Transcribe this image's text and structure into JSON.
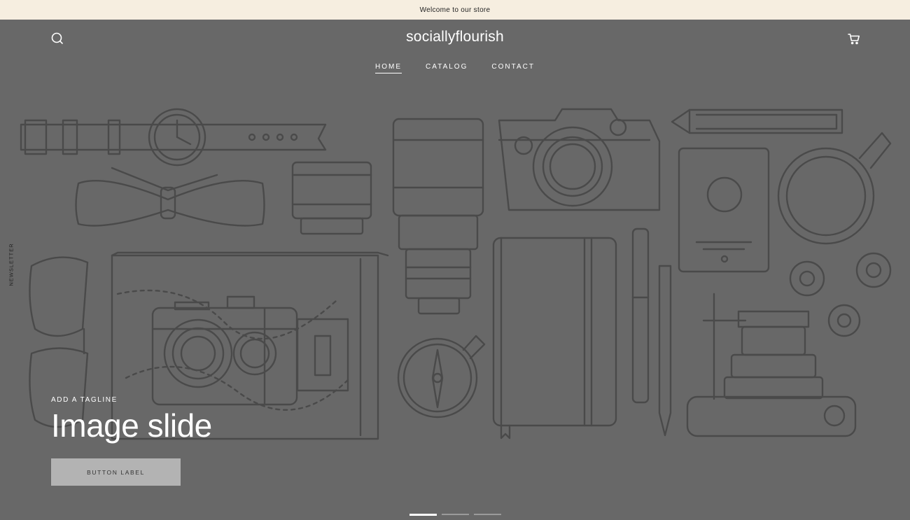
{
  "announcement": {
    "text": "Welcome to our store"
  },
  "header": {
    "logo": "sociallyflourish",
    "search_icon": "search-icon",
    "cart_icon": "cart-icon",
    "nav": [
      {
        "label": "HOME",
        "active": true
      },
      {
        "label": "CATALOG",
        "active": false
      },
      {
        "label": "CONTACT",
        "active": false
      }
    ]
  },
  "sidebar": {
    "newsletter": "NEWSLETTER"
  },
  "slide": {
    "tagline": "ADD A TAGLINE",
    "heading": "Image slide",
    "button": "BUTTON LABEL"
  },
  "slideshow": {
    "count": 3,
    "active_index": 0
  },
  "colors": {
    "announcement_bg": "#f6eee0",
    "hero_bg": "#686868",
    "line_art": "#4a4a4a",
    "button_bg": "#b3b3b3",
    "text_light": "#ffffff"
  }
}
